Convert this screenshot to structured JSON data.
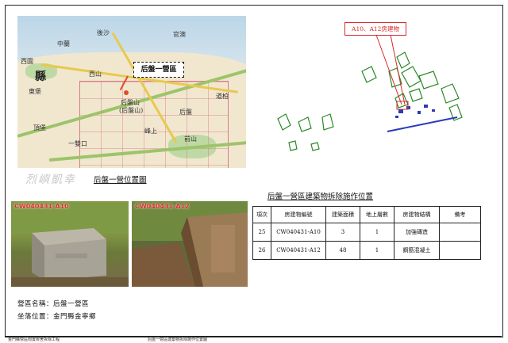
{
  "map": {
    "callout": "后盤一營區",
    "labels": [
      "縣",
      "西園",
      "後沙",
      "官澳",
      "中蘭",
      "西山",
      "后盤山",
      "(后盤山)",
      "東堡",
      "頂堡",
      "峰上",
      "前山",
      "一雙口",
      "后盤",
      "道柏"
    ]
  },
  "captions": {
    "location_map": "后盤一營位置圖",
    "demolition_table": "后盤一營區建築物拆除施作位置"
  },
  "watermark": "烈嶼凱幸",
  "site_plan": {
    "tag": "A10、A12房建物"
  },
  "photos": [
    {
      "tag": "CW040431-A10"
    },
    {
      "tag": "CW040431-A12"
    }
  ],
  "table": {
    "headers": [
      "項次",
      "房建物編號",
      "建築面積",
      "地上層數",
      "房建物結構",
      "備考"
    ],
    "rows": [
      [
        "25",
        "CW040431-A10",
        "3",
        "1",
        "加強磚造",
        ""
      ],
      [
        "26",
        "CW040431-A12",
        "48",
        "1",
        "鋼筋混凝土",
        ""
      ]
    ]
  },
  "info": {
    "camp_name": "營區名稱：后盤一營區",
    "location": "坐落位置：金門縣金寧鄉"
  },
  "footer": {
    "left": "金門縣營區閒置房舍拆除工程",
    "right": "后盤一營區建築物拆除施作位置圖"
  }
}
